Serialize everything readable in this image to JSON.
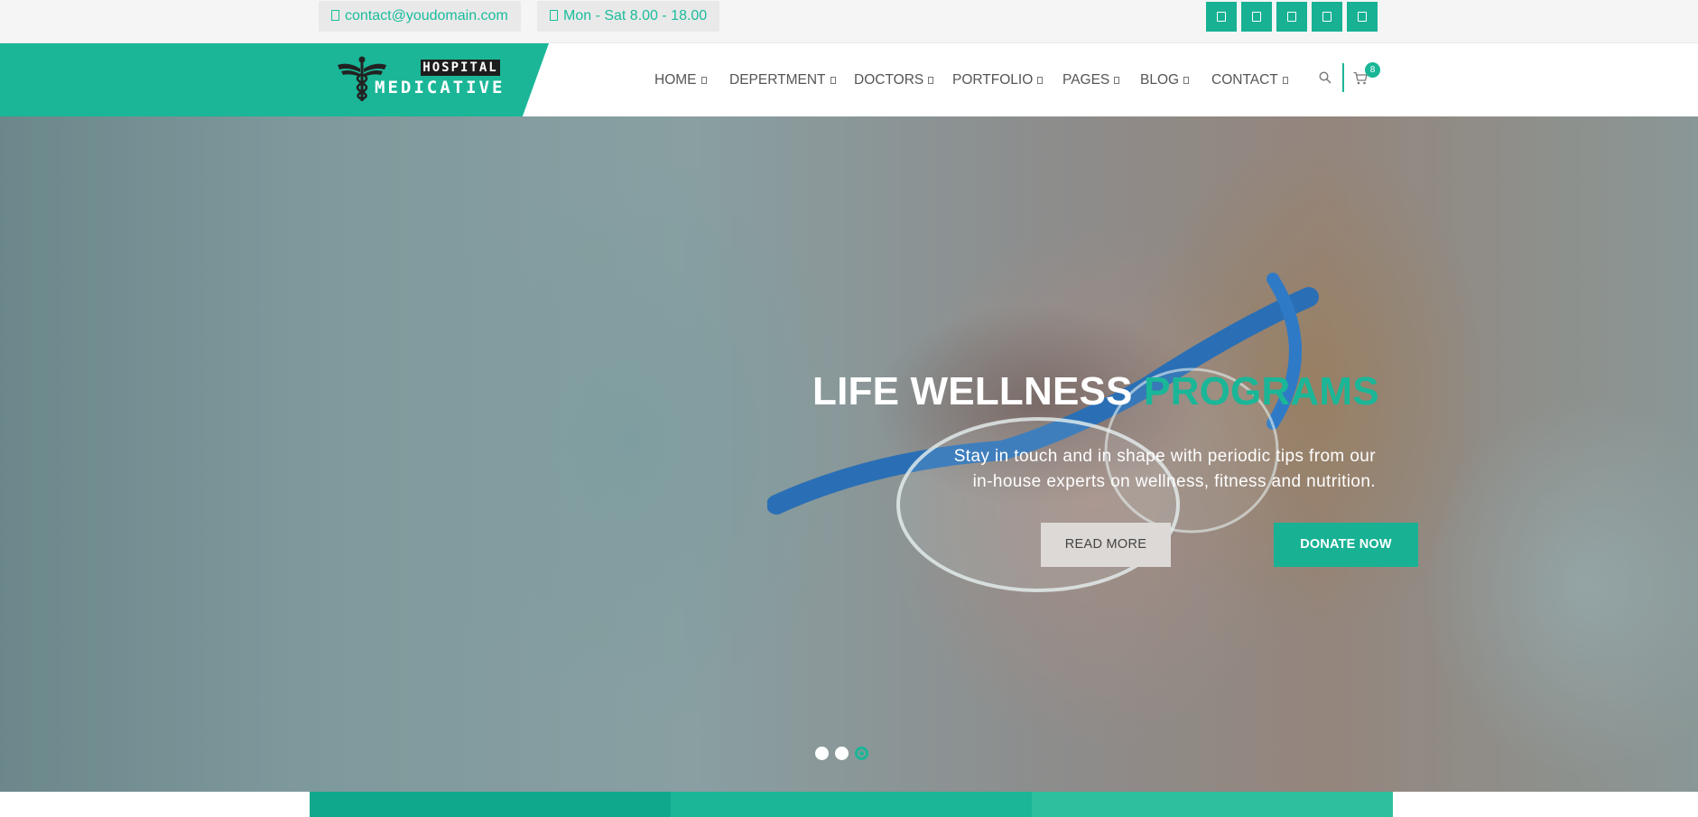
{
  "topbar": {
    "email": "contact@youdomain.com",
    "email_icon": "envelope-icon",
    "hours": "Mon - Sat 8.00 - 18.00",
    "hours_icon": "clock-icon",
    "social_icons": [
      "facebook-icon",
      "twitter-icon",
      "google-plus-icon",
      "linkedin-icon",
      "instagram-icon"
    ]
  },
  "header": {
    "logo": {
      "top": "HOSPITAL",
      "name": "MEDICATIVE"
    },
    "nav": [
      "HOME",
      "DEPERTMENT",
      "DOCTORS",
      "PORTFOLIO",
      "PAGES",
      "BLOG",
      "CONTACT"
    ],
    "cart_count": "8"
  },
  "hero": {
    "title_main": "LIFE WELLNESS",
    "title_accent": "PROGRAMS",
    "subtitle_line1": "Stay in touch and in shape with periodic tips from our",
    "subtitle_line2": "in-house experts on wellness, fitness and nutrition.",
    "read_more": "READ MORE",
    "donate_now": "DONATE NOW",
    "slides_count": 3,
    "active_slide": 3
  },
  "colors": {
    "accent": "#1ab697",
    "topbar_bg": "#f5f5f5",
    "nav_text": "#555555",
    "button_light": "#ddd9d6"
  }
}
